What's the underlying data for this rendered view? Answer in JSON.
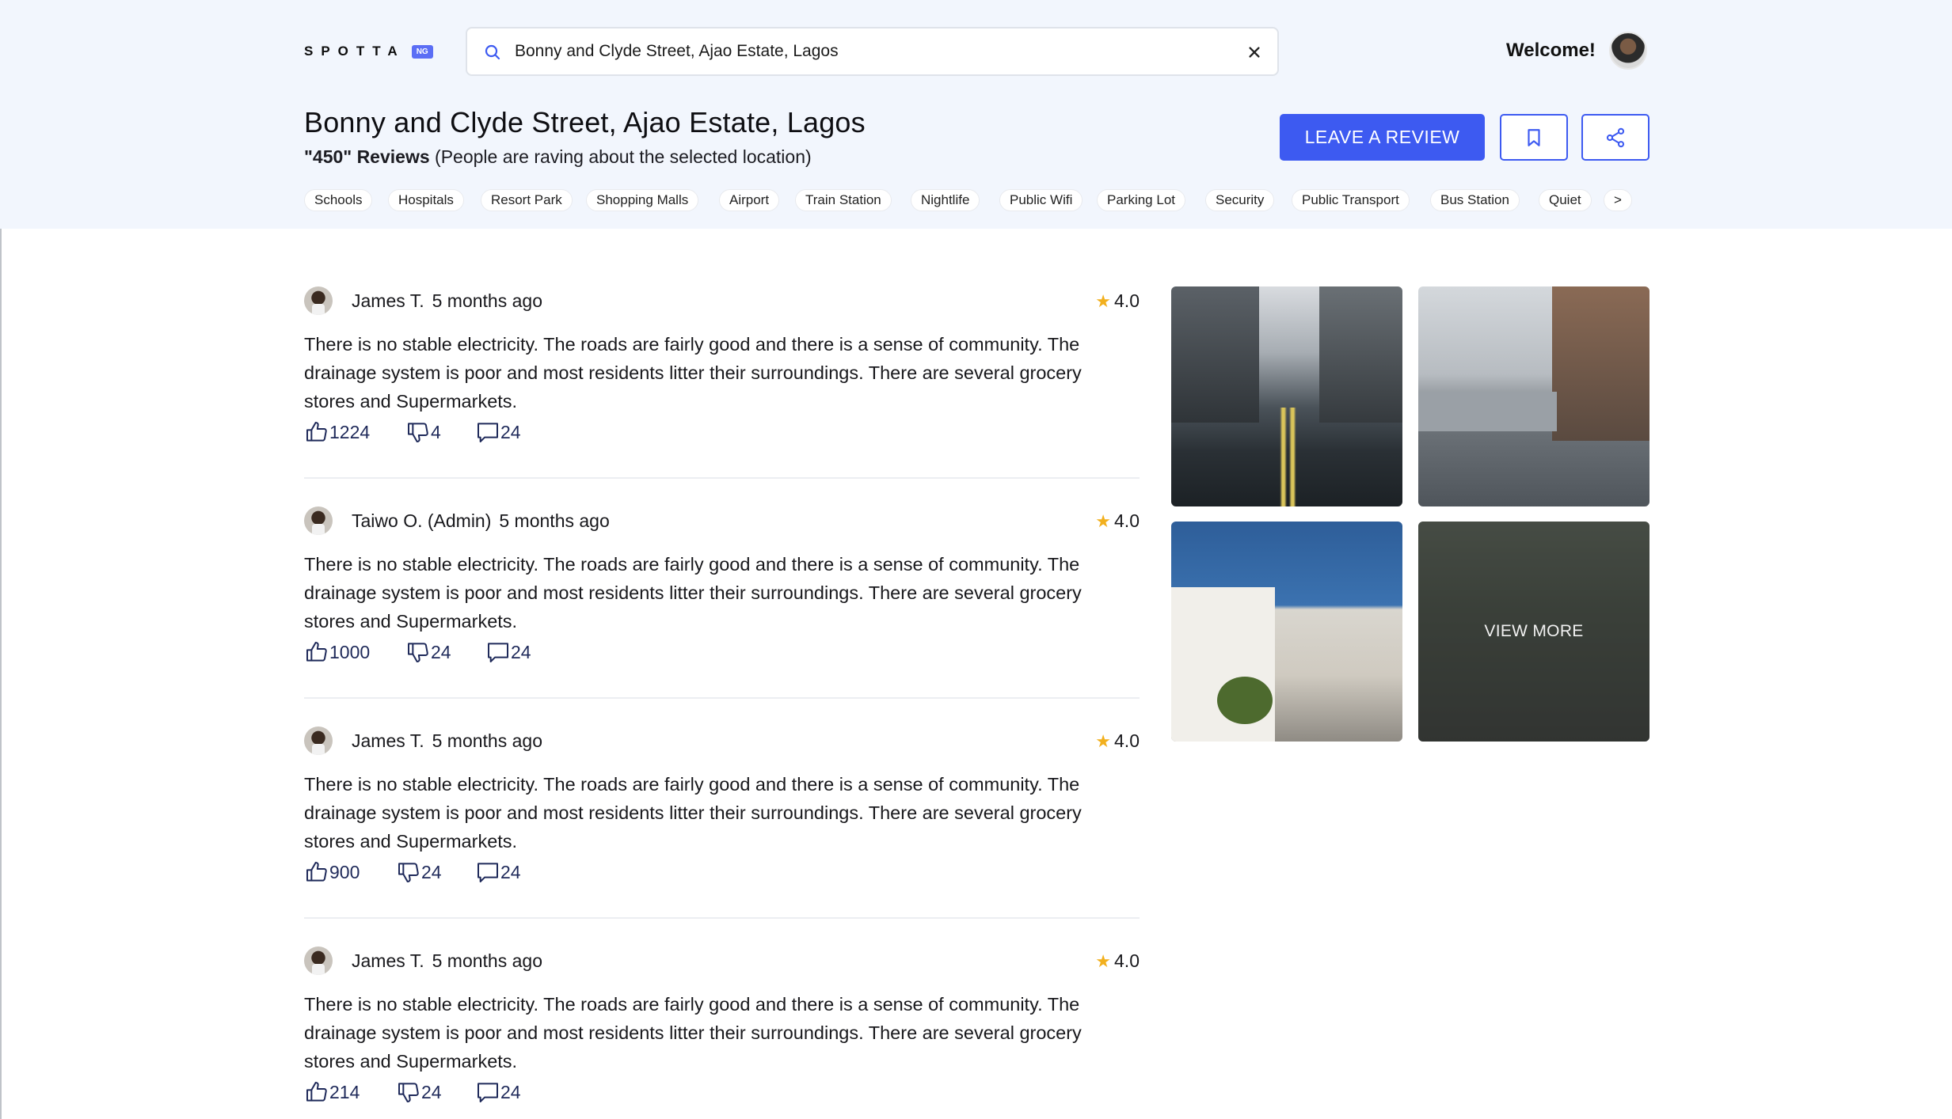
{
  "header": {
    "logo_text": "SPOTTA",
    "logo_badge": "NG",
    "search_value": "Bonny and Clyde Street, Ajao Estate, Lagos",
    "welcome": "Welcome!"
  },
  "location": {
    "title": "Bonny and Clyde Street, Ajao Estate, Lagos",
    "review_count": "\"450\" Reviews",
    "review_note": " (People are raving about the selected location)"
  },
  "actions": {
    "leave_review": "LEAVE A REVIEW"
  },
  "chips": [
    "Schools",
    "Hospitals",
    "Resort Park",
    "Shopping Malls",
    "Airport",
    "Train Station",
    "Nightlife",
    "Public Wifi",
    "Parking Lot",
    "Security",
    "Public Transport",
    "Bus Station",
    "Quiet",
    ">"
  ],
  "reviews": [
    {
      "author": "James T.",
      "time": "5 months ago",
      "rating": "4.0",
      "text": "There is no stable electricity. The roads are fairly good and there is a sense of community. The drainage system is poor and most residents litter their surroundings. There are several grocery stores and Supermarkets.",
      "likes": "1224",
      "dislikes": "4",
      "comments": "24"
    },
    {
      "author": "Taiwo O. (Admin)",
      "time": "5 months ago",
      "rating": "4.0",
      "text": "There is no stable electricity. The roads are fairly good and there is a sense of community. The drainage system is poor and most residents litter their surroundings. There are several grocery stores and Supermarkets.",
      "likes": "1000",
      "dislikes": "24",
      "comments": "24"
    },
    {
      "author": "James T.",
      "time": "5 months ago",
      "rating": "4.0",
      "text": "There is no stable electricity. The roads are fairly good and there is a sense of community. The drainage system is poor and most residents litter their surroundings. There are several grocery stores and Supermarkets.",
      "likes": "900",
      "dislikes": "24",
      "comments": "24"
    },
    {
      "author": "James T.",
      "time": "5 months ago",
      "rating": "4.0",
      "text": "There is no stable electricity. The roads are fairly good and there is a sense of community. The drainage system is poor and most residents litter their surroundings. There are several grocery stores and Supermarkets.",
      "likes": "214",
      "dislikes": "24",
      "comments": "24"
    }
  ],
  "gallery": {
    "view_more": "VIEW MORE"
  },
  "colors": {
    "accent": "#3d5af1",
    "header_bg": "#f2f6fd",
    "star": "#f2b01e"
  }
}
